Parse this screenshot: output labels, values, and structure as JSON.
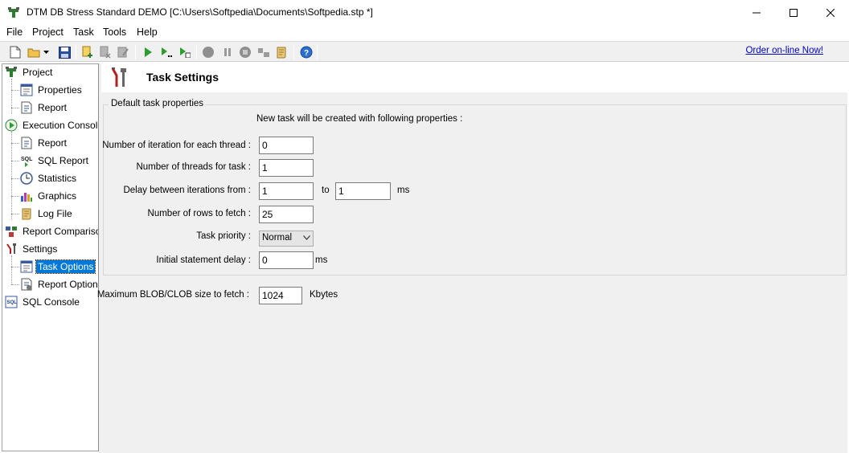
{
  "window": {
    "title": "DTM DB Stress Standard DEMO [C:\\Users\\Softpedia\\Documents\\Softpedia.stp *]"
  },
  "menu": [
    "File",
    "Project",
    "Task",
    "Tools",
    "Help"
  ],
  "toolbar": {
    "order_link": "Order on-line Now!"
  },
  "tree": {
    "items": [
      {
        "label": "Project",
        "icon": "project-icon"
      },
      {
        "label": "Properties",
        "icon": "properties-icon"
      },
      {
        "label": "Report",
        "icon": "report-icon"
      },
      {
        "label": "Execution Console",
        "icon": "execution-console-icon"
      },
      {
        "label": "Report",
        "icon": "report-icon"
      },
      {
        "label": "SQL Report",
        "icon": "sql-report-icon"
      },
      {
        "label": "Statistics",
        "icon": "statistics-icon"
      },
      {
        "label": "Graphics",
        "icon": "graphics-icon"
      },
      {
        "label": "Log File",
        "icon": "log-file-icon"
      },
      {
        "label": "Report Comparison",
        "icon": "report-comparison-icon"
      },
      {
        "label": "Settings",
        "icon": "settings-icon"
      },
      {
        "label": "Task Options",
        "icon": "task-options-icon",
        "selected": true
      },
      {
        "label": "Report Options",
        "icon": "report-options-icon"
      },
      {
        "label": "SQL Console",
        "icon": "sql-console-icon"
      }
    ]
  },
  "main": {
    "title": "Task Settings",
    "group_title": "Default task properties",
    "note": "New task will be created with following properties :",
    "fields": {
      "iterations_label": "Number of iteration for each thread :",
      "iterations_value": "0",
      "threads_label": "Number of threads for task :",
      "threads_value": "1",
      "delay_label": "Delay between iterations from :",
      "delay_from": "1",
      "delay_to_label": "to",
      "delay_to": "1",
      "delay_unit": "ms",
      "rows_label": "Number of rows to fetch :",
      "rows_value": "25",
      "priority_label": "Task priority :",
      "priority_value": "Normal",
      "stmt_delay_label": "Initial statement delay :",
      "stmt_delay_value": "0",
      "stmt_delay_unit": "ms",
      "blob_label": "Maximum BLOB/CLOB size to fetch :",
      "blob_value": "1024",
      "blob_unit": "Kbytes"
    }
  }
}
